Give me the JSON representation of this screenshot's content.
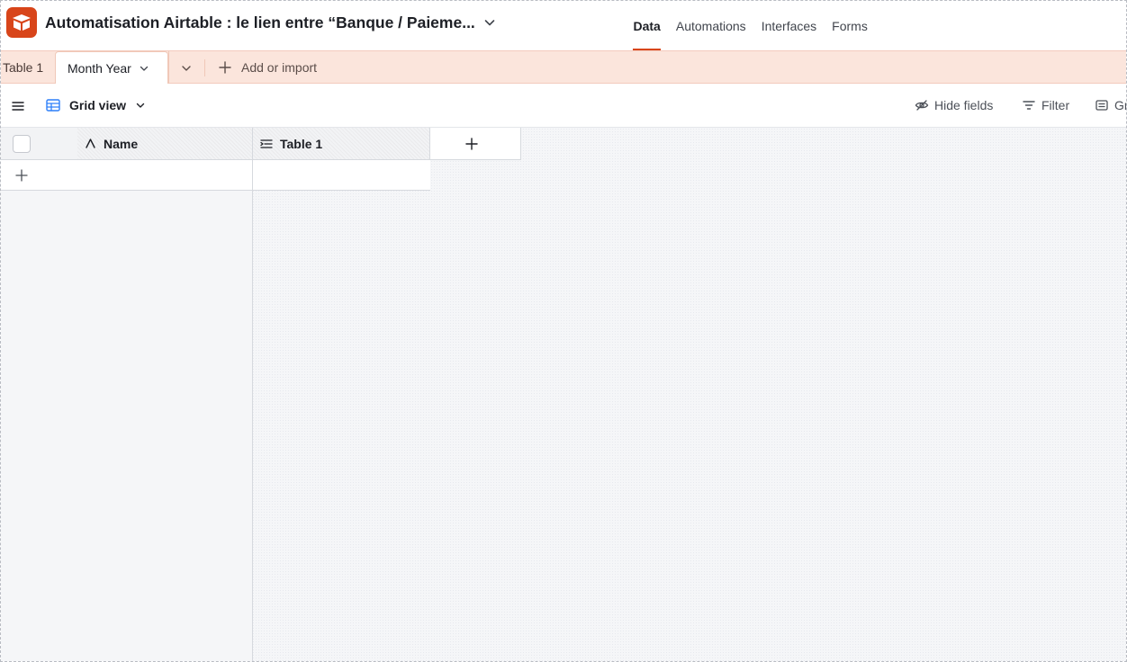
{
  "topbar": {
    "base_title": "Automatisation Airtable : le lien entre “Banque / Paieme...",
    "logo_icon": "airtable-logo",
    "brand_color": "#d8451a",
    "nav": [
      {
        "label": "Data",
        "active": true
      },
      {
        "label": "Automations",
        "active": false
      },
      {
        "label": "Interfaces",
        "active": false
      },
      {
        "label": "Forms",
        "active": false
      }
    ]
  },
  "tabbar": {
    "tables": [
      {
        "label": "Table 1",
        "active": false
      },
      {
        "label": "Month Year",
        "active": true
      }
    ],
    "add_import_label": "Add or import",
    "background_color": "#fbe5dc"
  },
  "viewbar": {
    "view_name": "Grid view",
    "view_icon": "grid-icon",
    "actions": [
      {
        "label": "Hide fields",
        "icon": "eye-slash-icon"
      },
      {
        "label": "Filter",
        "icon": "filter-icon"
      },
      {
        "label": "Gr",
        "icon": "group-icon"
      }
    ]
  },
  "grid": {
    "columns": [
      {
        "label": "Name",
        "icon": "text-field-icon"
      },
      {
        "label": "Table 1",
        "icon": "long-text-icon"
      }
    ],
    "rows": []
  }
}
